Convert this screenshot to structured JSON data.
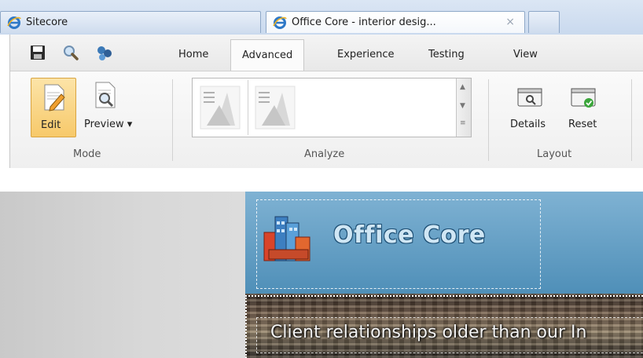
{
  "browser": {
    "tabs": [
      {
        "label": "Sitecore"
      },
      {
        "label": "Office Core - interior desig...",
        "close": "×"
      }
    ]
  },
  "ribbon": {
    "tabs": [
      "Home",
      "Advanced",
      "Experience",
      "Testing",
      "View"
    ],
    "active_tab": "Advanced",
    "groups": {
      "mode": {
        "label": "Mode",
        "edit": "Edit",
        "preview": "Preview ▾"
      },
      "analyze": {
        "label": "Analyze"
      },
      "layout": {
        "label": "Layout",
        "details": "Details",
        "reset": "Reset"
      }
    }
  },
  "page": {
    "logo_text": "Office Core",
    "slogan": "Client relationships older than our In"
  },
  "colors": {
    "accent_edit": "#f7c96a",
    "header_blue": "#4f8fb8"
  }
}
